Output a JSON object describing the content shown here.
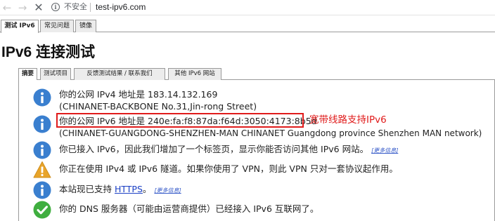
{
  "browser": {
    "security_text": "不安全",
    "url": "test-ipv6.com",
    "icons": [
      "back-arrow-icon",
      "forward-arrow-icon",
      "stop-icon",
      "info-icon"
    ]
  },
  "top_tabs": [
    {
      "label": "测试 IPv6",
      "active": true
    },
    {
      "label": "常见问题",
      "active": false
    },
    {
      "label": "镜像",
      "active": false
    }
  ],
  "page_title": "IPv6 连接测试",
  "inner_tabs": [
    {
      "label": "摘要",
      "active": true
    },
    {
      "label": "测试项目",
      "active": false
    },
    {
      "label": "反馈测试结果 / 联系我们",
      "active": false
    },
    {
      "label": "其他 IPv6 网站",
      "active": false
    }
  ],
  "results": {
    "ipv4_line1": "你的公网 IPv4 地址是 183.14.132.169",
    "ipv4_line2": "(CHINANET-BACKBONE No.31,Jin-rong Street)",
    "ipv6_line1": "你的公网 IPv6 地址是 240e:fa:f8:87da:f64d:3050:4173:8b5d",
    "ipv6_line2": "(CHINANET-GUANGDONG-SHENZHEN-MAN CHINANET Guangdong province Shenzhen MAN network)",
    "tab_notice": "你已接入 IPv6，因此我们增加了一个标签页，显示你能否访问其他 IPv6 网站。",
    "tunnel_warning": "你正在使用 IPv4 或 IPv6 隧道。如果你使用了 VPN，则此 VPN 只对一套协议起作用。",
    "https_prefix": "本站现已支持 ",
    "https_link": "HTTPS",
    "https_suffix": "。",
    "dns_notice": "你的 DNS 服务器（可能由运营商提供）已经接入 IPv6 互联网了。",
    "more_info": "[更多信息]"
  },
  "annotation": {
    "text": "宽带线路支持IPv6",
    "color": "#e01b1b"
  },
  "colors": {
    "info_icon": "#3a7fcf",
    "warning_icon": "#e8a42a",
    "success_icon": "#3fae3f"
  }
}
